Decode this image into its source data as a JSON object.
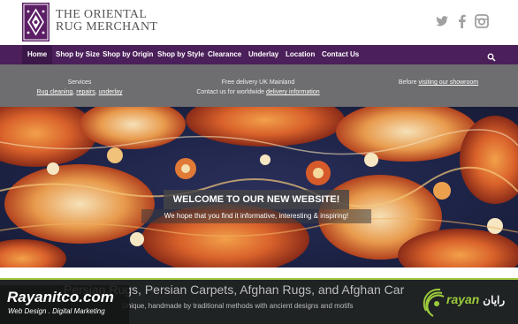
{
  "brand": {
    "name_line1": "THE ORIENTAL",
    "name_line2": "RUG MERCHANT",
    "logo_color": "#5c1f66"
  },
  "social": [
    "twitter-icon",
    "facebook-icon",
    "instagram-icon"
  ],
  "nav": {
    "items": [
      {
        "label": "Home",
        "active": true
      },
      {
        "label": "Shop by Size"
      },
      {
        "label": "Shop by Origin"
      },
      {
        "label": "Shop by Style"
      },
      {
        "label": "Clearance"
      },
      {
        "label": "Underlay"
      },
      {
        "label": "Location"
      },
      {
        "label": "Contact Us"
      }
    ],
    "search_icon": "search-icon",
    "bg_color": "#4b1f5a"
  },
  "info": {
    "services": {
      "title": "Services",
      "link1": "Rug cleaning",
      "sep1": ", ",
      "link2": "repairs",
      "sep2": ", ",
      "link3": "underlay"
    },
    "delivery": {
      "line1": "Free delivery UK Mainland",
      "line2_prefix": "Contact us for worldwide ",
      "line2_link": "delivery information"
    },
    "showroom": {
      "prefix": "Before ",
      "link": "visiting our showroom"
    }
  },
  "hero": {
    "title": "WELCOME TO OUR NEW WEBSITE!",
    "subtitle": "We hope that you find it informative, interesting & inspiring!"
  },
  "content": {
    "headline": "Persian Rugs, Persian Carpets, Afghan Rugs, and Afghan Car",
    "tagline": "Unique, handmade by traditional methods with ancient designs and motifs"
  },
  "watermark": {
    "site": "Rayanitco.com",
    "slogan": "Web Design . Digital Marketing",
    "logo_text": "rayan",
    "logo_script": "رایان",
    "accent": "#9ccb3b"
  }
}
